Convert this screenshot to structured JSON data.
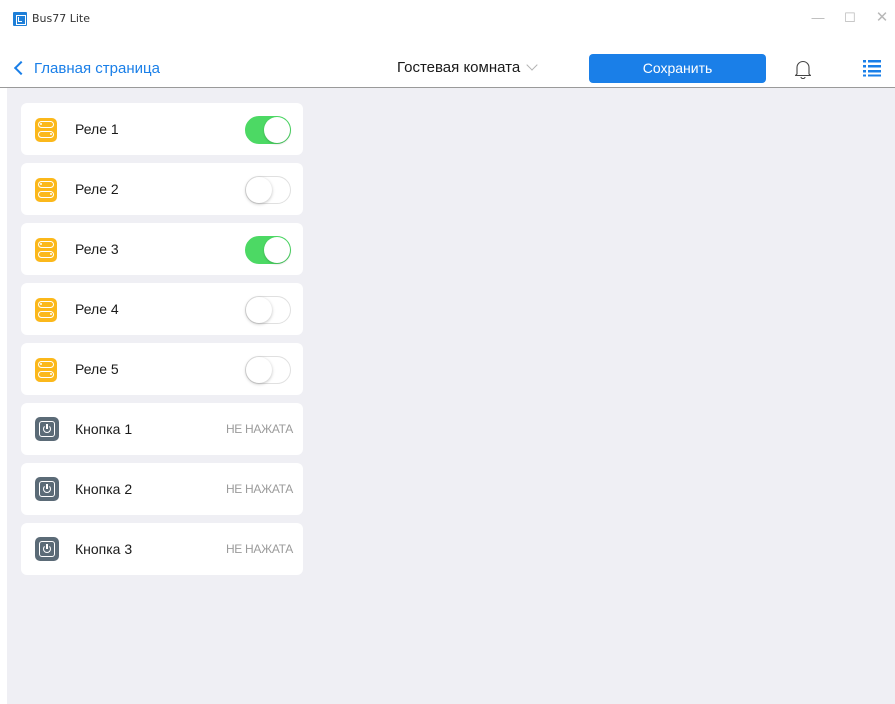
{
  "window": {
    "title": "Bus77 Lite",
    "minimize": "—",
    "maximize": "☐",
    "close": "✕"
  },
  "nav": {
    "back_label": "Главная страница",
    "room": "Гостевая комната",
    "save_label": "Сохранить"
  },
  "relays": [
    {
      "label": "Реле 1",
      "on": true
    },
    {
      "label": "Реле 2",
      "on": false
    },
    {
      "label": "Реле 3",
      "on": true
    },
    {
      "label": "Реле 4",
      "on": false
    },
    {
      "label": "Реле 5",
      "on": false
    }
  ],
  "buttons": [
    {
      "label": "Кнопка 1",
      "state": "НЕ НАЖАТА"
    },
    {
      "label": "Кнопка 2",
      "state": "НЕ НАЖАТА"
    },
    {
      "label": "Кнопка 3",
      "state": "НЕ НАЖАТА"
    }
  ],
  "colors": {
    "accent": "#1a7fe8",
    "toggle_on": "#4cd964",
    "relay_icon": "#fbb81b",
    "button_icon": "#5b6b77",
    "background": "#efeff4"
  }
}
